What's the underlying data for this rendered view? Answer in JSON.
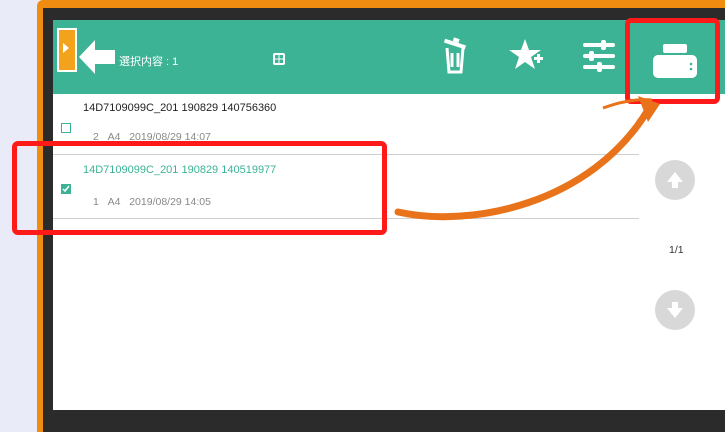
{
  "header": {
    "selection_label": "選択内容 : 1"
  },
  "files": [
    {
      "name": "14D7109099C_201 190829 140756360",
      "copies": "2",
      "paper": "A4",
      "date": "2019/08/29 14:07",
      "selected": false
    },
    {
      "name": "14D7109099C_201 190829 140519977",
      "copies": "1",
      "paper": "A4",
      "date": "2019/08/29 14:05",
      "selected": true
    }
  ],
  "pager": {
    "indicator": "1/1"
  },
  "icons": [
    "side-tab-arrow-icon",
    "back-arrow-icon",
    "grid-icon",
    "trash-icon",
    "star-add-icon",
    "sliders-icon",
    "print-icon",
    "page-up-icon",
    "page-down-icon"
  ],
  "colors": {
    "accent": "#3bb394",
    "frame": "#f08c0f",
    "highlight": "#ff1a1a",
    "arrow": "#e8731a"
  }
}
